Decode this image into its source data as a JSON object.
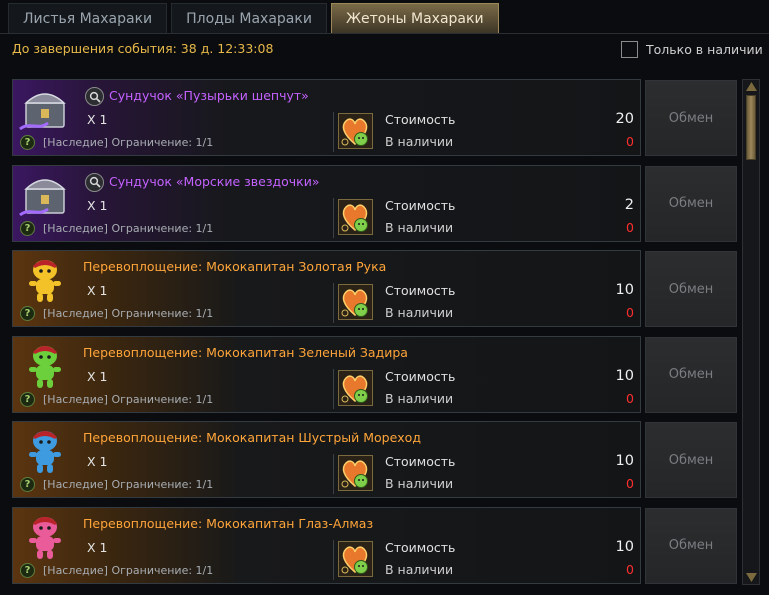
{
  "tabs": [
    {
      "label": "Листья Махараки"
    },
    {
      "label": "Плоды Махараки"
    },
    {
      "label": "Жетоны Махараки"
    }
  ],
  "active_tab_index": 2,
  "timer": "До завершения события: 38 д. 12:33:08",
  "filter": {
    "label": "Только в наличии",
    "checked": false
  },
  "labels": {
    "cost": "Стоимость",
    "available": "В наличии",
    "exchange": "Обмен",
    "help": "?"
  },
  "colors": {
    "accent_gold": "#e7b84a",
    "rarity_purple": "#c462ff",
    "rarity_orange": "#ffa53a",
    "insufficient_red": "#ff2e2e"
  },
  "items": [
    {
      "name": "Сундучок «Пузырьки шепчут»",
      "qty": "X 1",
      "limit": "[Наследие] Ограничение: 1/1",
      "cost": "20",
      "available": "0",
      "rarity": "purple",
      "icon": "chest-icon",
      "icon_color": "#8a8a9a"
    },
    {
      "name": "Сундучок «Морские звездочки»",
      "qty": "X 1",
      "limit": "[Наследие] Ограничение: 1/1",
      "cost": "2",
      "available": "0",
      "rarity": "purple",
      "icon": "chest-icon",
      "icon_color": "#8a8a9a"
    },
    {
      "name": "Перевоплощение: Мококапитан Золотая Рука",
      "qty": "X 1",
      "limit": "[Наследие] Ограничение: 1/1",
      "cost": "10",
      "available": "0",
      "rarity": "orange",
      "icon": "mokocaptain-icon",
      "icon_color": "#f2c228"
    },
    {
      "name": "Перевоплощение: Мококапитан Зеленый Задира",
      "qty": "X 1",
      "limit": "[Наследие] Ограничение: 1/1",
      "cost": "10",
      "available": "0",
      "rarity": "orange",
      "icon": "mokocaptain-icon",
      "icon_color": "#6ccf3c"
    },
    {
      "name": "Перевоплощение: Мококапитан Шустрый Мореход",
      "qty": "X 1",
      "limit": "[Наследие] Ограничение: 1/1",
      "cost": "10",
      "available": "0",
      "rarity": "orange",
      "icon": "mokocaptain-icon",
      "icon_color": "#3e9be0"
    },
    {
      "name": "Перевоплощение: Мококапитан Глаз-Алмаз",
      "qty": "X 1",
      "limit": "[Наследие] Ограничение: 1/1",
      "cost": "10",
      "available": "0",
      "rarity": "orange",
      "icon": "mokocaptain-icon",
      "icon_color": "#ea5b9a"
    }
  ]
}
